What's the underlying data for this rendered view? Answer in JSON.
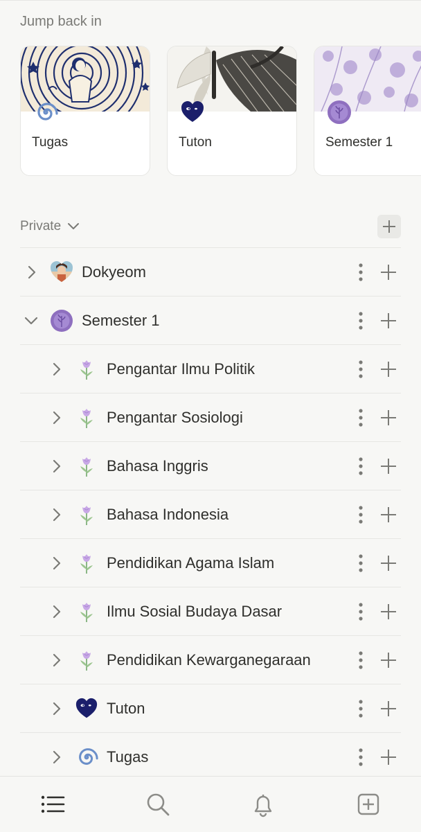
{
  "jump_back": {
    "title": "Jump back in",
    "cards": [
      {
        "label": "Tugas",
        "icon": "spiral-icon",
        "cover": "illustration-cover"
      },
      {
        "label": "Tuton",
        "icon": "heart-icon",
        "cover": "butterfly-cover"
      },
      {
        "label": "Semester 1",
        "icon": "wax-seal-icon",
        "cover": "lavender-cover"
      }
    ]
  },
  "sidebar": {
    "section_label": "Private",
    "items": [
      {
        "label": "Dokyeom",
        "icon": "heart-photo-icon",
        "expanded": false,
        "level": 0
      },
      {
        "label": "Semester 1",
        "icon": "wax-seal-icon",
        "expanded": true,
        "level": 0
      },
      {
        "label": "Pengantar Ilmu Politik",
        "icon": "tulip-icon",
        "expanded": false,
        "level": 1
      },
      {
        "label": "Pengantar Sosiologi",
        "icon": "tulip-icon",
        "expanded": false,
        "level": 1
      },
      {
        "label": "Bahasa Inggris",
        "icon": "tulip-icon",
        "expanded": false,
        "level": 1
      },
      {
        "label": "Bahasa Indonesia",
        "icon": "tulip-icon",
        "expanded": false,
        "level": 1
      },
      {
        "label": "Pendidikan Agama Islam",
        "icon": "tulip-icon",
        "expanded": false,
        "level": 1
      },
      {
        "label": "Ilmu Sosial Budaya Dasar",
        "icon": "tulip-icon",
        "expanded": false,
        "level": 1
      },
      {
        "label": "Pendidikan Kewarganegaraan",
        "icon": "tulip-icon",
        "expanded": false,
        "level": 1
      },
      {
        "label": "Tuton",
        "icon": "heart-icon",
        "expanded": false,
        "level": 1
      },
      {
        "label": "Tugas",
        "icon": "spiral-icon",
        "expanded": false,
        "level": 1
      }
    ]
  },
  "bottom_nav": {
    "tabs": [
      "home-list-icon",
      "search-icon",
      "bell-icon",
      "new-page-icon"
    ]
  },
  "colors": {
    "background": "#f7f7f5",
    "text": "#2f2f2c",
    "muted": "#7a7a76",
    "icon_gray": "#8c8c88",
    "purple": "#9a7bc8",
    "navy": "#1b1f6b",
    "spiral_blue": "#6b8fc9"
  }
}
